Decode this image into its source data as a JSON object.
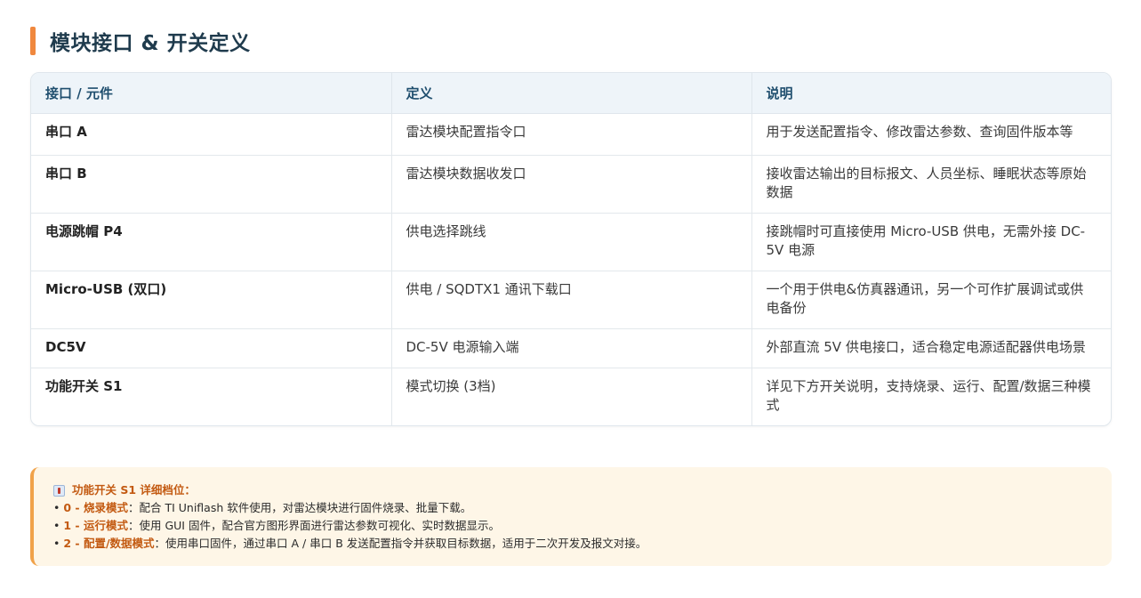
{
  "section": {
    "title": "模块接口 & 开关定义"
  },
  "table": {
    "headers": [
      "接口 / 元件",
      "定义",
      "说明"
    ],
    "rows": [
      {
        "name": "串口 A",
        "definition": "雷达模块配置指令口",
        "description": "用于发送配置指令、修改雷达参数、查询固件版本等"
      },
      {
        "name": "串口 B",
        "definition": "雷达模块数据收发口",
        "description": "接收雷达输出的目标报文、人员坐标、睡眠状态等原始数据"
      },
      {
        "name": "电源跳帽 P4",
        "definition": "供电选择跳线",
        "description": "接跳帽时可直接使用 Micro-USB 供电，无需外接 DC-5V 电源"
      },
      {
        "name": "Micro-USB (双口)",
        "definition": "供电 / SQDTX1 通讯下载口",
        "description": "一个用于供电&仿真器通讯，另一个可作扩展调试或供电备份"
      },
      {
        "name": "DC5V",
        "definition": "DC-5V 电源输入端",
        "description": "外部直流 5V 供电接口，适合稳定电源适配器供电场景"
      },
      {
        "name": "功能开关 S1",
        "definition": "模式切换 (3档)",
        "description": "详见下方开关说明，支持烧录、运行、配置/数据三种模式"
      }
    ]
  },
  "note": {
    "icon": "pushpin-icon",
    "heading": "功能开关 S1 详细档位：",
    "items": [
      {
        "bullet": "•",
        "mode": "0 - 烧录模式",
        "sep": "：",
        "text": "配合 TI Uniflash 软件使用，对雷达模块进行固件烧录、批量下载。"
      },
      {
        "bullet": "•",
        "mode": "1 - 运行模式",
        "sep": "：",
        "text": "使用 GUI 固件，配合官方图形界面进行雷达参数可视化、实时数据显示。"
      },
      {
        "bullet": "•",
        "mode": "2 - 配置/数据模式",
        "sep": "：",
        "text": "使用串口固件，通过串口 A / 串口 B 发送配置指令并获取目标数据，适用于二次开发及报文对接。"
      }
    ]
  },
  "colors": {
    "accent": "#f0883e",
    "header_bg": "#eef4f9",
    "note_bg": "#fef6e7",
    "mode_text": "#c35a12"
  }
}
